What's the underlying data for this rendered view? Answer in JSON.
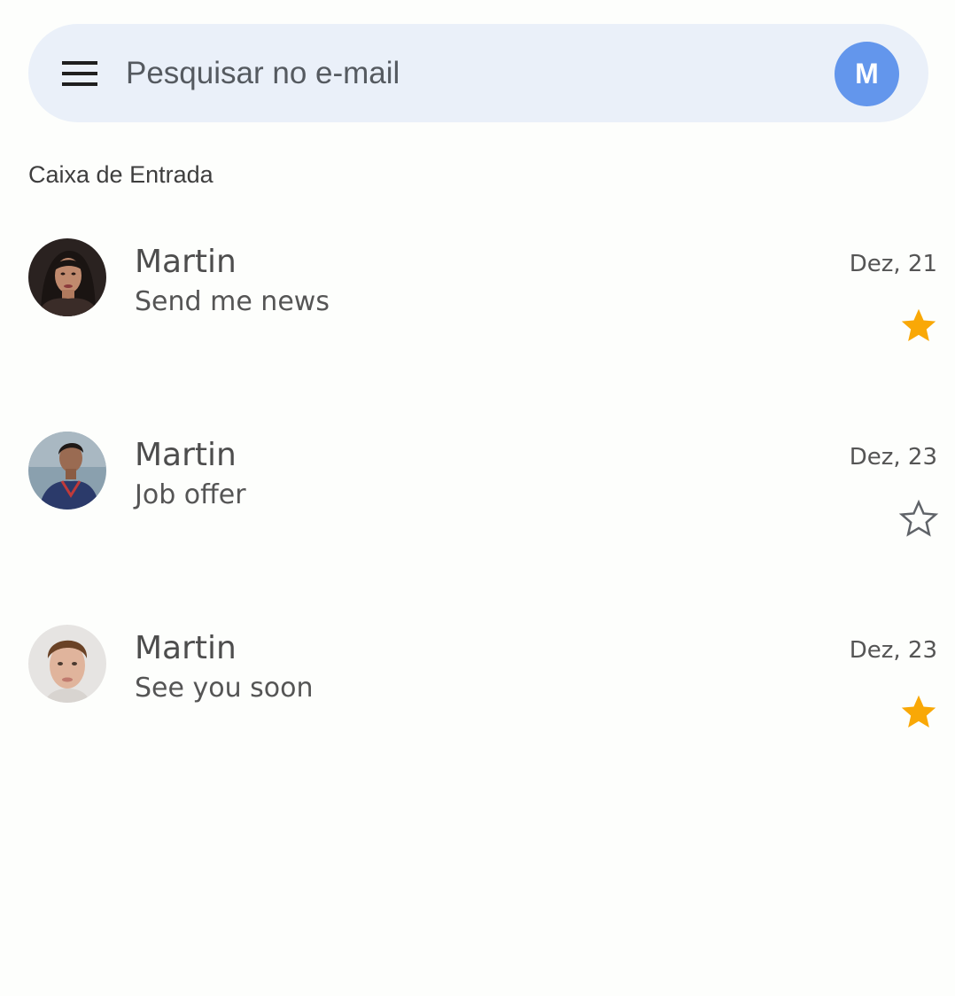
{
  "search": {
    "placeholder": "Pesquisar no e-mail"
  },
  "account": {
    "initial": "M",
    "color": "#6396ec"
  },
  "inbox": {
    "title": "Caixa de Entrada"
  },
  "icons": {
    "menu": "hamburger-menu-icon",
    "star_filled": "star-filled-icon",
    "star_outline": "star-outline-icon"
  },
  "colors": {
    "star": "#f9a806",
    "star_outline": "#5f6368"
  },
  "emails": [
    {
      "sender": "Martin",
      "subject": "Send me news",
      "date": "Dez, 21",
      "starred": true
    },
    {
      "sender": "Martin",
      "subject": "Job offer",
      "date": "Dez, 23",
      "starred": false
    },
    {
      "sender": "Martin",
      "subject": "See you soon",
      "date": "Dez, 23",
      "starred": true
    }
  ]
}
